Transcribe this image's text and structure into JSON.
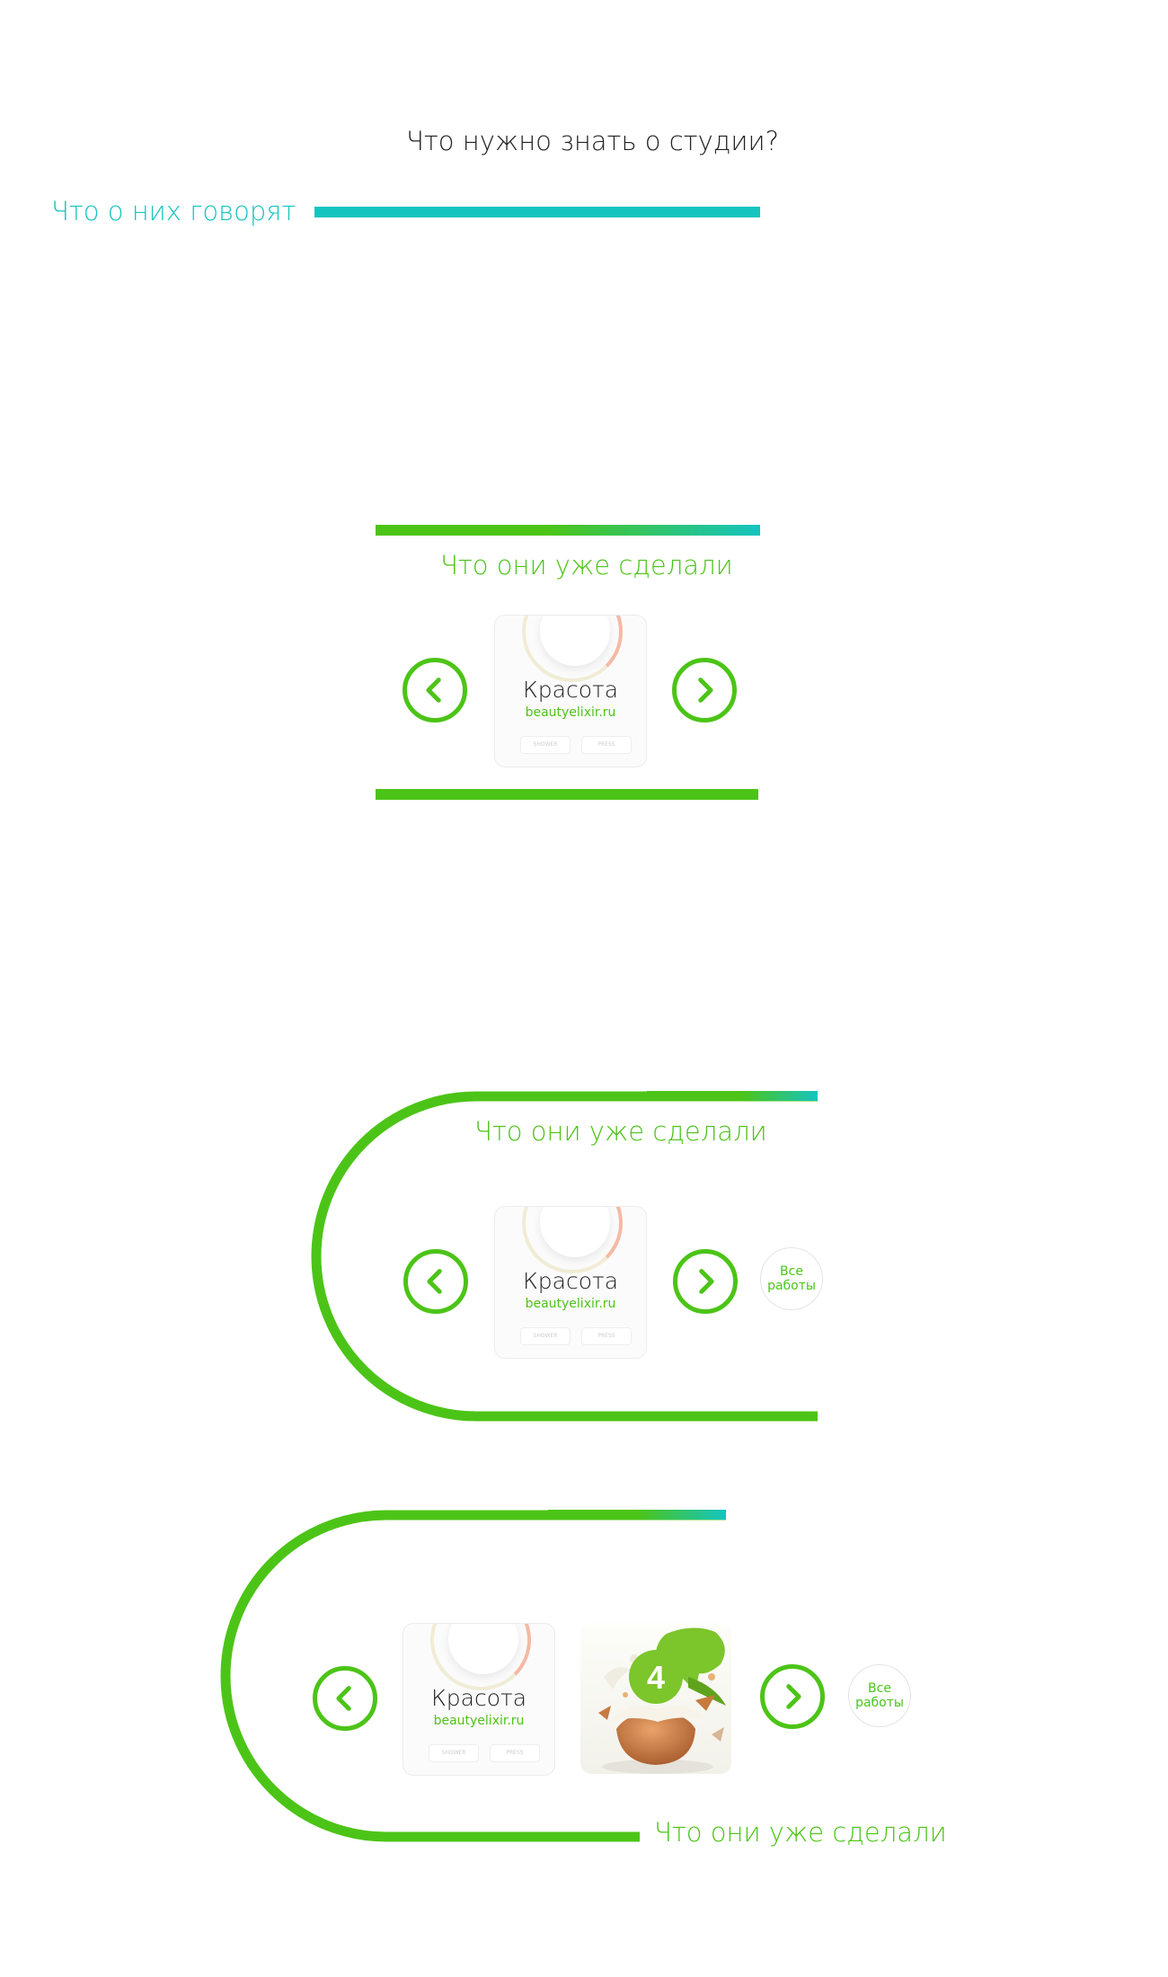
{
  "top": {
    "title": "Что нужно знать о студии?",
    "subtitle": "Что о них говорят"
  },
  "section_heading": "Что они уже сделали",
  "card": {
    "title": "Красота",
    "url": "beautyelixir.ru",
    "btn_left": "SHOWER",
    "btn_right": "PRESS"
  },
  "egg_card": {
    "badge": "4"
  },
  "all_works": "Все работы",
  "colors": {
    "green": "#4cc417",
    "teal": "#16c4bf",
    "title_text": "#222222"
  },
  "icons": {
    "prev": "chevron-left-icon",
    "next": "chevron-right-icon"
  }
}
